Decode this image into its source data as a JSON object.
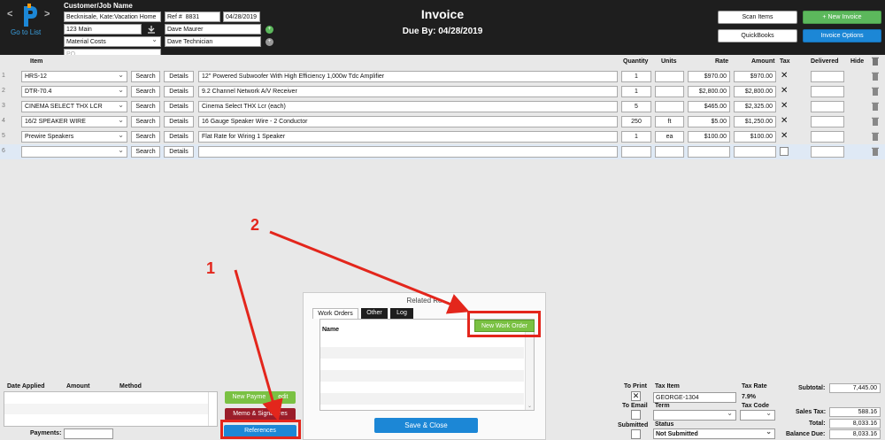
{
  "header": {
    "goto_label": "Go to List",
    "customer_label": "Customer/Job Name",
    "customer_value": "Becknisale, Kate:Vacation Home",
    "ref_label": "Ref #",
    "ref_value": "8831",
    "date_value": "04/28/2019",
    "address_value": "123 Main",
    "rep_value": "Dave Maurer",
    "class_value": "Material Costs",
    "tech_value": "Dave Technician",
    "po_placeholder": "PO",
    "title": "Invoice",
    "due": "Due By: 04/28/2019",
    "buttons": {
      "scan_items": "Scan Items",
      "new_invoice": "+ New Invoice",
      "quickbooks": "QuickBooks",
      "invoice_options": "Invoice Options"
    },
    "colors": {
      "green": "#5cb85c",
      "blue": "#1c87d6",
      "dark": "#1e1e1e"
    }
  },
  "table": {
    "headers": {
      "item": "Item",
      "quantity": "Quantity",
      "units": "Units",
      "rate": "Rate",
      "amount": "Amount",
      "tax": "Tax",
      "delivered": "Delivered",
      "hide": "Hide"
    },
    "search_label": "Search",
    "details_label": "Details",
    "rows": [
      {
        "num": "1",
        "item": "HRS-12",
        "desc": "12\" Powered Subwoofer With High Efficiency 1,000w Tdc Amplifier",
        "qty": "1",
        "units": "",
        "rate": "$970.00",
        "amount": "$970.00",
        "tax": "✕"
      },
      {
        "num": "2",
        "item": "DTR-70.4",
        "desc": "9.2 Channel Network A/V Receiver",
        "qty": "1",
        "units": "",
        "rate": "$2,800.00",
        "amount": "$2,800.00",
        "tax": "✕"
      },
      {
        "num": "3",
        "item": "CINEMA SELECT THX LCR",
        "desc": "Cinema Select THX Lcr (each)",
        "qty": "5",
        "units": "",
        "rate": "$465.00",
        "amount": "$2,325.00",
        "tax": "✕"
      },
      {
        "num": "4",
        "item": "16/2 SPEAKER WIRE",
        "desc": "16 Gauge Speaker Wire - 2 Conductor",
        "qty": "250",
        "units": "ft",
        "rate": "$5.00",
        "amount": "$1,250.00",
        "tax": "✕"
      },
      {
        "num": "5",
        "item": "Prewire Speakers",
        "desc": "Flat Rate for Wiring 1 Speaker",
        "qty": "1",
        "units": "ea",
        "rate": "$100.00",
        "amount": "$100.00",
        "tax": "✕"
      },
      {
        "num": "6",
        "item": "",
        "desc": "",
        "qty": "",
        "units": "",
        "rate": "",
        "amount": "",
        "tax": ""
      }
    ]
  },
  "related": {
    "title": "Related Re",
    "tabs": [
      "Work Orders",
      "Other",
      "Log"
    ],
    "col_name": "Name",
    "new_work_order": "New Work Order",
    "save_close": "Save & Close"
  },
  "payments": {
    "date_applied": "Date Applied",
    "amount": "Amount",
    "method": "Method",
    "payments_label": "Payments:",
    "new_payment": "New Payme",
    "new_payment_tail": "edit",
    "memo": "Memo & Signa",
    "memo_tail": "tures",
    "references": "References"
  },
  "footer": {
    "to_print": "To Print",
    "to_email": "To Email",
    "submitted": "Submitted",
    "tax_item_label": "Tax Item",
    "tax_item_value": "GEORGE-1304",
    "tax_rate_label": "Tax Rate",
    "tax_rate_value": "7.9%",
    "term_label": "Term",
    "tax_code_label": "Tax Code",
    "status_label": "Status",
    "status_value": "Not Submitted",
    "subtotal_label": "Subtotal:",
    "subtotal_value": "7,445.00",
    "sales_tax_label": "Sales Tax:",
    "sales_tax_value": "588.16",
    "total_label": "Total:",
    "total_value": "8,033.16",
    "balance_label": "Balance Due:",
    "balance_value": "8,033.16"
  },
  "annotations": {
    "one": "1",
    "two": "2",
    "color": "#e3261c"
  }
}
